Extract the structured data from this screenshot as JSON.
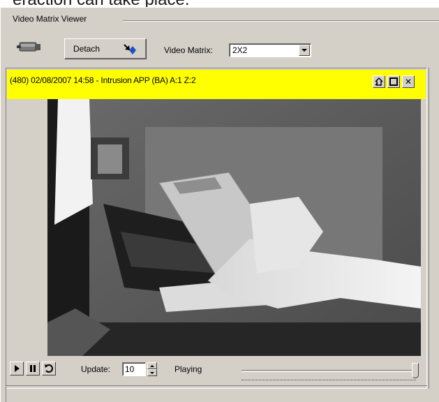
{
  "doc": {
    "partial_text": "eraction can take place."
  },
  "viewer": {
    "group_title": "Video Matrix Viewer",
    "detach_label": "Detach",
    "matrix_label": "Video Matrix:",
    "matrix_value": "2X2"
  },
  "camera": {
    "title": "(480) 02/08/2007 14:58 - Intrusion APP (BA) A:1 Z:2",
    "title_bg": "#ffff00",
    "buttons": [
      "home-icon",
      "maximize-icon",
      "close-icon"
    ],
    "close_glyph": "✕"
  },
  "controls": {
    "update_label": "Update:",
    "update_value": "10",
    "status": "Playing",
    "slider_level": 1.0
  }
}
